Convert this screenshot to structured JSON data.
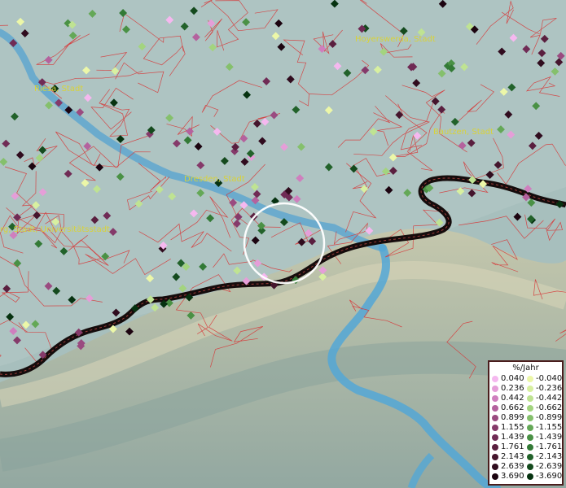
{
  "map": {
    "places": [
      {
        "name": "Riesa, Stadt"
      },
      {
        "name": "Hoyerswerda, Stadt"
      },
      {
        "name": "Bautzen, Stadt"
      },
      {
        "name": "Dresden, Stadt"
      },
      {
        "name": "rg, Stadt, Universitätsstadt"
      }
    ]
  },
  "legend": {
    "title": "%/Jahr",
    "rows": [
      {
        "pos": "0.040",
        "neg": "-0.040",
        "pos_color": "#f5b8ef",
        "neg_color": "#ecf7a8"
      },
      {
        "pos": "0.236",
        "neg": "-0.236",
        "pos_color": "#e59ed8",
        "neg_color": "#d8f0a0"
      },
      {
        "pos": "0.442",
        "neg": "-0.442",
        "pos_color": "#cf7fbe",
        "neg_color": "#bfe392"
      },
      {
        "pos": "0.662",
        "neg": "-0.662",
        "pos_color": "#b4629e",
        "neg_color": "#a3d47f"
      },
      {
        "pos": "0.899",
        "neg": "-0.899",
        "pos_color": "#9a4b80",
        "neg_color": "#85c06c"
      },
      {
        "pos": "1.155",
        "neg": "-1.155",
        "pos_color": "#853a6a",
        "neg_color": "#64a857"
      },
      {
        "pos": "1.439",
        "neg": "-1.439",
        "pos_color": "#702b55",
        "neg_color": "#4a9145"
      },
      {
        "pos": "1.761",
        "neg": "-1.761",
        "pos_color": "#5a1f3f",
        "neg_color": "#337a36"
      },
      {
        "pos": "2.143",
        "neg": "-2.143",
        "pos_color": "#45152d",
        "neg_color": "#22622a"
      },
      {
        "pos": "2.639",
        "neg": "-2.639",
        "pos_color": "#300c1e",
        "neg_color": "#144a1d"
      },
      {
        "pos": "3.690",
        "neg": "-3.690",
        "pos_color": "#1c0410",
        "neg_color": "#063210"
      }
    ]
  }
}
